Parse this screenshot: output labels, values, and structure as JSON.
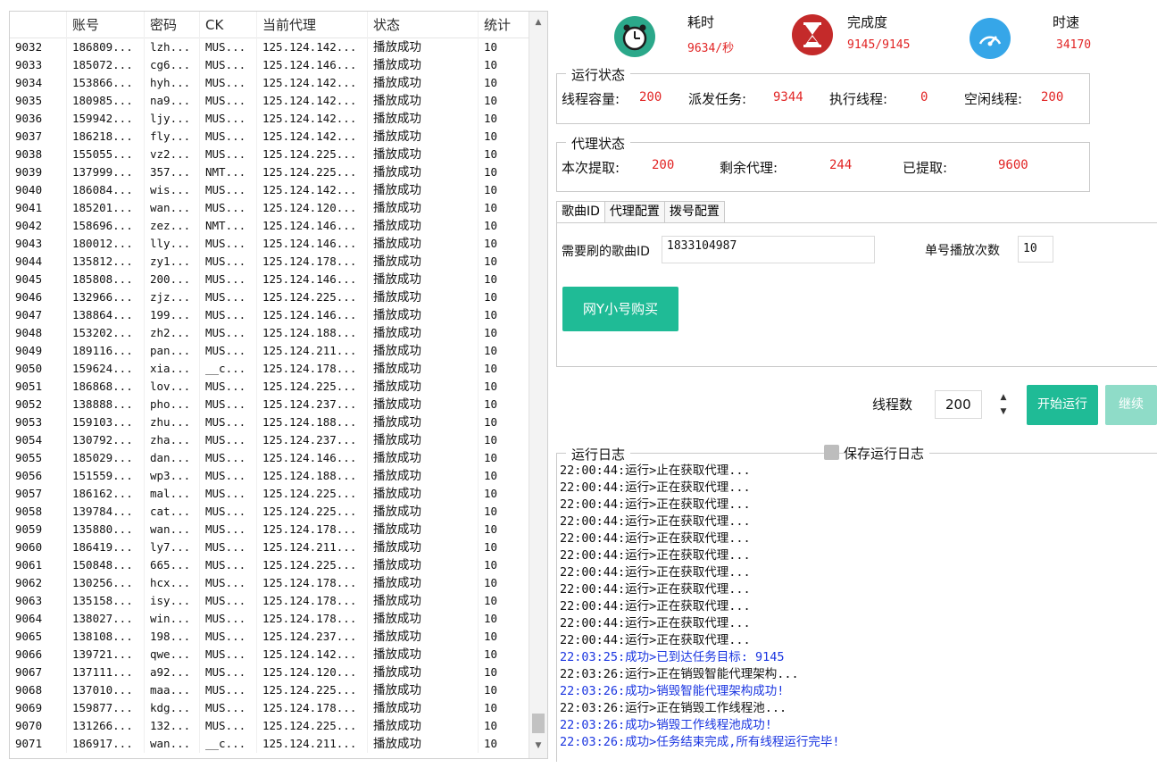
{
  "table": {
    "columns": [
      "",
      "账号",
      "密码",
      "CK",
      "当前代理",
      "状态",
      "统计"
    ],
    "rows": [
      [
        "9032",
        "186809...",
        "lzh...",
        "MUS...",
        "125.124.142...",
        "播放成功",
        "10"
      ],
      [
        "9033",
        "185072...",
        "cg6...",
        "MUS...",
        "125.124.146...",
        "播放成功",
        "10"
      ],
      [
        "9034",
        "153866...",
        "hyh...",
        "MUS...",
        "125.124.142...",
        "播放成功",
        "10"
      ],
      [
        "9035",
        "180985...",
        "na9...",
        "MUS...",
        "125.124.142...",
        "播放成功",
        "10"
      ],
      [
        "9036",
        "159942...",
        "ljy...",
        "MUS...",
        "125.124.142...",
        "播放成功",
        "10"
      ],
      [
        "9037",
        "186218...",
        "fly...",
        "MUS...",
        "125.124.142...",
        "播放成功",
        "10"
      ],
      [
        "9038",
        "155055...",
        "vz2...",
        "MUS...",
        "125.124.225...",
        "播放成功",
        "10"
      ],
      [
        "9039",
        "137999...",
        "357...",
        "NMT...",
        "125.124.225...",
        "播放成功",
        "10"
      ],
      [
        "9040",
        "186084...",
        "wis...",
        "MUS...",
        "125.124.142...",
        "播放成功",
        "10"
      ],
      [
        "9041",
        "185201...",
        "wan...",
        "MUS...",
        "125.124.120...",
        "播放成功",
        "10"
      ],
      [
        "9042",
        "158696...",
        "zez...",
        "NMT...",
        "125.124.146...",
        "播放成功",
        "10"
      ],
      [
        "9043",
        "180012...",
        "lly...",
        "MUS...",
        "125.124.146...",
        "播放成功",
        "10"
      ],
      [
        "9044",
        "135812...",
        "zy1...",
        "MUS...",
        "125.124.178...",
        "播放成功",
        "10"
      ],
      [
        "9045",
        "185808...",
        "200...",
        "MUS...",
        "125.124.146...",
        "播放成功",
        "10"
      ],
      [
        "9046",
        "132966...",
        "zjz...",
        "MUS...",
        "125.124.225...",
        "播放成功",
        "10"
      ],
      [
        "9047",
        "138864...",
        "199...",
        "MUS...",
        "125.124.146...",
        "播放成功",
        "10"
      ],
      [
        "9048",
        "153202...",
        "zh2...",
        "MUS...",
        "125.124.188...",
        "播放成功",
        "10"
      ],
      [
        "9049",
        "189116...",
        "pan...",
        "MUS...",
        "125.124.211...",
        "播放成功",
        "10"
      ],
      [
        "9050",
        "159624...",
        "xia...",
        "__c...",
        "125.124.178...",
        "播放成功",
        "10"
      ],
      [
        "9051",
        "186868...",
        "lov...",
        "MUS...",
        "125.124.225...",
        "播放成功",
        "10"
      ],
      [
        "9052",
        "138888...",
        "pho...",
        "MUS...",
        "125.124.237...",
        "播放成功",
        "10"
      ],
      [
        "9053",
        "159103...",
        "zhu...",
        "MUS...",
        "125.124.188...",
        "播放成功",
        "10"
      ],
      [
        "9054",
        "130792...",
        "zha...",
        "MUS...",
        "125.124.237...",
        "播放成功",
        "10"
      ],
      [
        "9055",
        "185029...",
        "dan...",
        "MUS...",
        "125.124.146...",
        "播放成功",
        "10"
      ],
      [
        "9056",
        "151559...",
        "wp3...",
        "MUS...",
        "125.124.188...",
        "播放成功",
        "10"
      ],
      [
        "9057",
        "186162...",
        "mal...",
        "MUS...",
        "125.124.225...",
        "播放成功",
        "10"
      ],
      [
        "9058",
        "139784...",
        "cat...",
        "MUS...",
        "125.124.225...",
        "播放成功",
        "10"
      ],
      [
        "9059",
        "135880...",
        "wan...",
        "MUS...",
        "125.124.178...",
        "播放成功",
        "10"
      ],
      [
        "9060",
        "186419...",
        "ly7...",
        "MUS...",
        "125.124.211...",
        "播放成功",
        "10"
      ],
      [
        "9061",
        "150848...",
        "665...",
        "MUS...",
        "125.124.225...",
        "播放成功",
        "10"
      ],
      [
        "9062",
        "130256...",
        "hcx...",
        "MUS...",
        "125.124.178...",
        "播放成功",
        "10"
      ],
      [
        "9063",
        "135158...",
        "isy...",
        "MUS...",
        "125.124.178...",
        "播放成功",
        "10"
      ],
      [
        "9064",
        "138027...",
        "win...",
        "MUS...",
        "125.124.178...",
        "播放成功",
        "10"
      ],
      [
        "9065",
        "138108...",
        "198...",
        "MUS...",
        "125.124.237...",
        "播放成功",
        "10"
      ],
      [
        "9066",
        "139721...",
        "qwe...",
        "MUS...",
        "125.124.142...",
        "播放成功",
        "10"
      ],
      [
        "9067",
        "137111...",
        "a92...",
        "MUS...",
        "125.124.120...",
        "播放成功",
        "10"
      ],
      [
        "9068",
        "137010...",
        "maa...",
        "MUS...",
        "125.124.225...",
        "播放成功",
        "10"
      ],
      [
        "9069",
        "159877...",
        "kdg...",
        "MUS...",
        "125.124.178...",
        "播放成功",
        "10"
      ],
      [
        "9070",
        "131266...",
        "132...",
        "MUS...",
        "125.124.225...",
        "播放成功",
        "10"
      ],
      [
        "9071",
        "186917...",
        "wan...",
        "__c...",
        "125.124.211...",
        "播放成功",
        "10"
      ]
    ]
  },
  "stats": {
    "elapsed_label": "耗时",
    "elapsed_value": "9634/秒",
    "progress_label": "完成度",
    "progress_value": "9145/9145",
    "speed_label": "时速",
    "speed_value": "34170"
  },
  "run_status": {
    "title": "运行状态",
    "capacity_label": "线程容量:",
    "capacity_value": "200",
    "dispatch_label": "派发任务:",
    "dispatch_value": "9344",
    "exec_label": "执行线程:",
    "exec_value": "0",
    "idle_label": "空闲线程:",
    "idle_value": "200"
  },
  "proxy_status": {
    "title": "代理状态",
    "this_label": "本次提取:",
    "this_value": "200",
    "remain_label": "剩余代理:",
    "remain_value": "244",
    "fetched_label": "已提取:",
    "fetched_value": "9600"
  },
  "tabs": [
    "歌曲ID",
    "代理配置",
    "拨号配置"
  ],
  "song": {
    "id_label": "需要刷的歌曲ID",
    "id_value": "1833104987",
    "plays_label": "单号播放次数",
    "plays_value": "10",
    "buy_button": "网Y小号购买"
  },
  "threads": {
    "label": "线程数",
    "value": "200"
  },
  "buttons": {
    "start": "开始运行",
    "continue": "继续"
  },
  "log": {
    "title": "运行日志",
    "save_label": "保存运行日志",
    "lines": [
      {
        "text": "22:00:44:运行>止在获取代理...",
        "color": "#111111"
      },
      {
        "text": "22:00:44:运行>正在获取代理...",
        "color": "#111111"
      },
      {
        "text": "22:00:44:运行>正在获取代理...",
        "color": "#111111"
      },
      {
        "text": "22:00:44:运行>正在获取代理...",
        "color": "#111111"
      },
      {
        "text": "22:00:44:运行>正在获取代理...",
        "color": "#111111"
      },
      {
        "text": "22:00:44:运行>正在获取代理...",
        "color": "#111111"
      },
      {
        "text": "22:00:44:运行>正在获取代理...",
        "color": "#111111"
      },
      {
        "text": "22:00:44:运行>正在获取代理...",
        "color": "#111111"
      },
      {
        "text": "22:00:44:运行>正在获取代理...",
        "color": "#111111"
      },
      {
        "text": "22:00:44:运行>正在获取代理...",
        "color": "#111111"
      },
      {
        "text": "22:00:44:运行>正在获取代理...",
        "color": "#111111"
      },
      {
        "text": "22:03:25:成功>已到达任务目标: 9145",
        "color": "#1a35e0"
      },
      {
        "text": "22:03:26:运行>正在销毁智能代理架构...",
        "color": "#111111"
      },
      {
        "text": "22:03:26:成功>销毁智能代理架构成功!",
        "color": "#1a35e0"
      },
      {
        "text": "22:03:26:运行>正在销毁工作线程池...",
        "color": "#111111"
      },
      {
        "text": "22:03:26:成功>销毁工作线程池成功!",
        "color": "#1a35e0"
      },
      {
        "text": "22:03:26:成功>任务结束完成,所有线程运行完毕!",
        "color": "#1a35e0"
      }
    ]
  },
  "colors": {
    "accent": "#1fbb96",
    "value_red": "#e12424",
    "log_success": "#1a35e0"
  }
}
